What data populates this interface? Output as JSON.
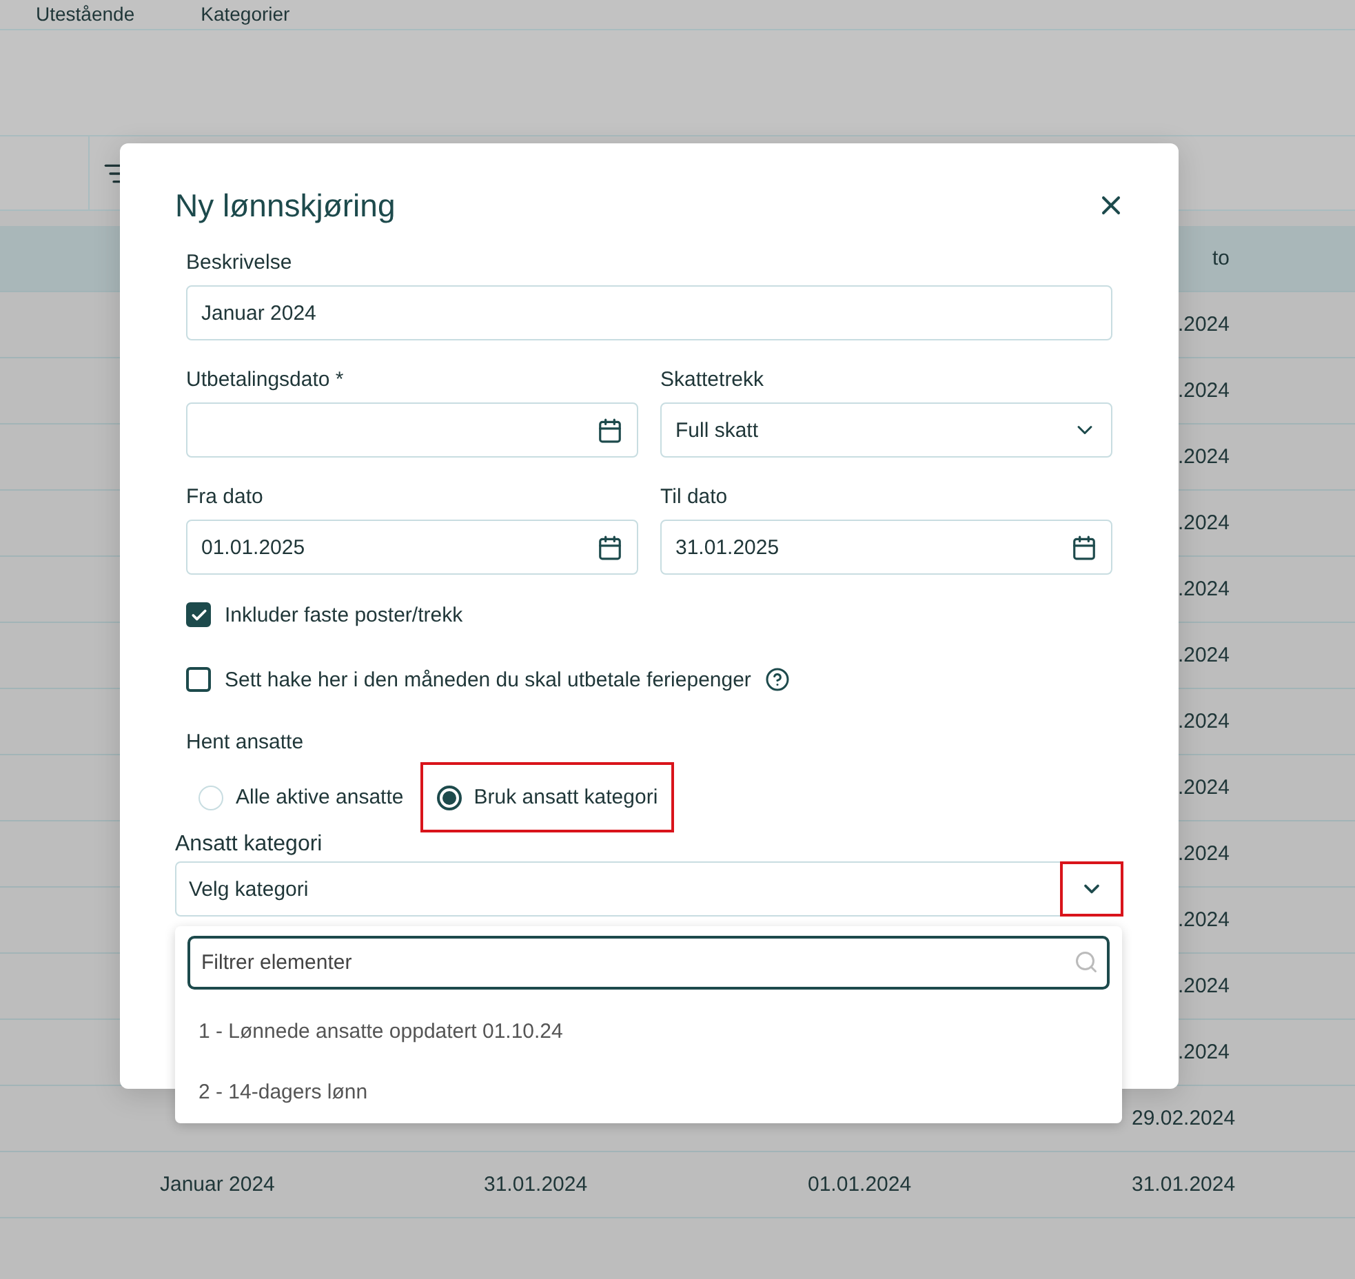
{
  "tabs": [
    {
      "label": "Utestående",
      "selected": false
    },
    {
      "label": "Kategorier",
      "selected": false
    }
  ],
  "table": {
    "header": {
      "column_4": "to"
    },
    "rows": [
      {
        "column_4": ".2024"
      },
      {
        "column_4": ".2024"
      },
      {
        "column_4": ".2024"
      },
      {
        "column_4": ".2024"
      },
      {
        "column_4": ".2024"
      },
      {
        "column_4": ".2024"
      },
      {
        "column_4": ".2024"
      },
      {
        "column_4": ".2024"
      },
      {
        "column_4": ".2024"
      },
      {
        "column_4": ".2024"
      },
      {
        "column_4": ".2024"
      },
      {
        "column_4": ".2024"
      },
      {
        "column_4": "29.02.2024"
      },
      {
        "column_1": "Januar 2024",
        "column_2": "31.01.2024",
        "column_3": "01.01.2024",
        "column_4": "31.01.2024"
      }
    ]
  },
  "dialog": {
    "title": "Ny lønnskjøring",
    "description": {
      "label": "Beskrivelse",
      "value": "Januar 2024"
    },
    "field_rows": [
      [
        {
          "kind": "date",
          "label": "Utbetalingsdato *"
        },
        {
          "kind": "select",
          "label": "Skattetrekk",
          "value": "Full skatt"
        }
      ],
      [
        {
          "kind": "date",
          "label": "Fra dato",
          "value": "01.01.2025"
        },
        {
          "kind": "date",
          "label": "Til dato",
          "value": "31.01.2025"
        }
      ]
    ],
    "checkboxes": [
      {
        "label": "Inkluder faste poster/trekk",
        "checked": true,
        "help": false
      },
      {
        "label": "Sett hake her i den måneden du skal utbetale feriepenger",
        "checked": false,
        "help": true
      }
    ],
    "employees": {
      "label": "Hent ansatte",
      "options": [
        {
          "label": "Alle aktive ansatte",
          "selected": false,
          "highlighted": false
        },
        {
          "label": "Bruk ansatt kategori",
          "selected": true,
          "highlighted": true
        }
      ]
    },
    "category": {
      "label": "Ansatt kategori",
      "placeholder": "Velg kategori",
      "toggle_highlighted": true,
      "expanded": true,
      "filter_placeholder": "Filtrer elementer",
      "options": [
        "1 - Lønnede ansatte oppdatert 01.10.24",
        "2 - 14-dagers lønn"
      ]
    }
  }
}
